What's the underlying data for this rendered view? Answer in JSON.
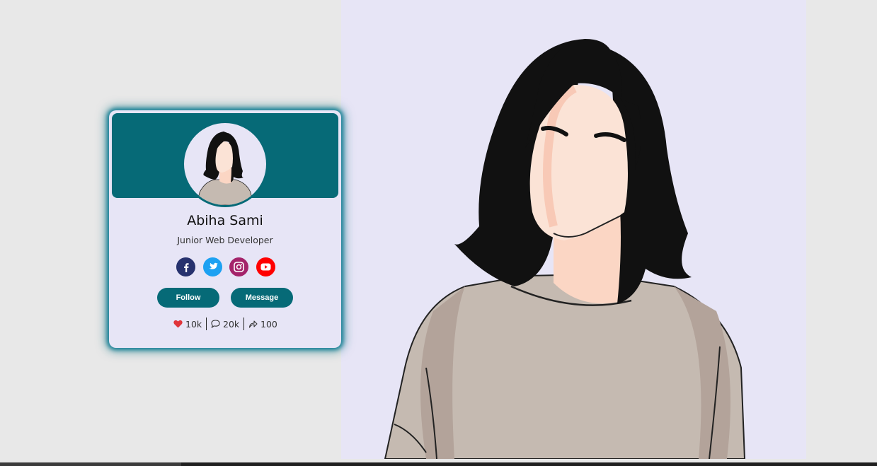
{
  "profile": {
    "name": "Abiha Sami",
    "role": "Junior Web Developer"
  },
  "socials": [
    {
      "icon": "facebook-icon",
      "color": "#27326e"
    },
    {
      "icon": "twitter-icon",
      "color": "#1da1f2"
    },
    {
      "icon": "instagram-icon",
      "color": "#a4236a"
    },
    {
      "icon": "youtube-icon",
      "color": "#ff0000"
    }
  ],
  "buttons": {
    "follow": "Follow",
    "message": "Message"
  },
  "stats": {
    "likes": "10k",
    "comments": "20k",
    "shares": "100"
  },
  "colors": {
    "accent": "#066a77",
    "card_background": "#e7e5f6",
    "page_background": "#e8e8e8",
    "heart": "#e0343a"
  }
}
